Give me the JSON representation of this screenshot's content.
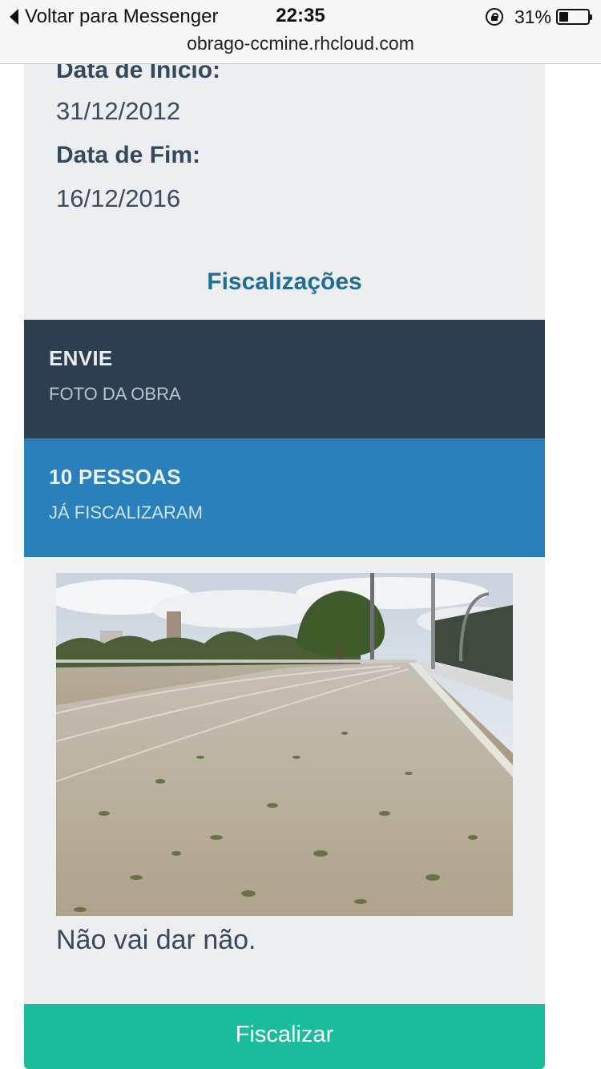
{
  "status_bar": {
    "back_label": "Voltar para Messenger",
    "time": "22:35",
    "battery_percent": "31%",
    "battery_level": 0.31,
    "lock_icon": "orientation-lock-icon",
    "battery_icon": "battery-icon"
  },
  "browser": {
    "url": "obrago-ccmine.rhcloud.com"
  },
  "details": {
    "start_label": "Data de Início:",
    "start_value": "31/12/2012",
    "end_label": "Data de Fim:",
    "end_value": "16/12/2016"
  },
  "section": {
    "title": "Fiscalizações"
  },
  "send_panel": {
    "heading": "ENVIE",
    "sub": "FOTO DA OBRA"
  },
  "count_panel": {
    "heading": "10 PESSOAS",
    "sub": "JÁ FISCALIZARAM"
  },
  "inspection": {
    "comment": "Não vai dar não."
  },
  "action": {
    "label": "Fiscalizar"
  },
  "colors": {
    "card_background": "#eceef0",
    "dark_panel": "#2d3e50",
    "blue_panel": "#2980ba",
    "title_blue": "#1f6e98",
    "button_green": "#1bbc9b"
  }
}
